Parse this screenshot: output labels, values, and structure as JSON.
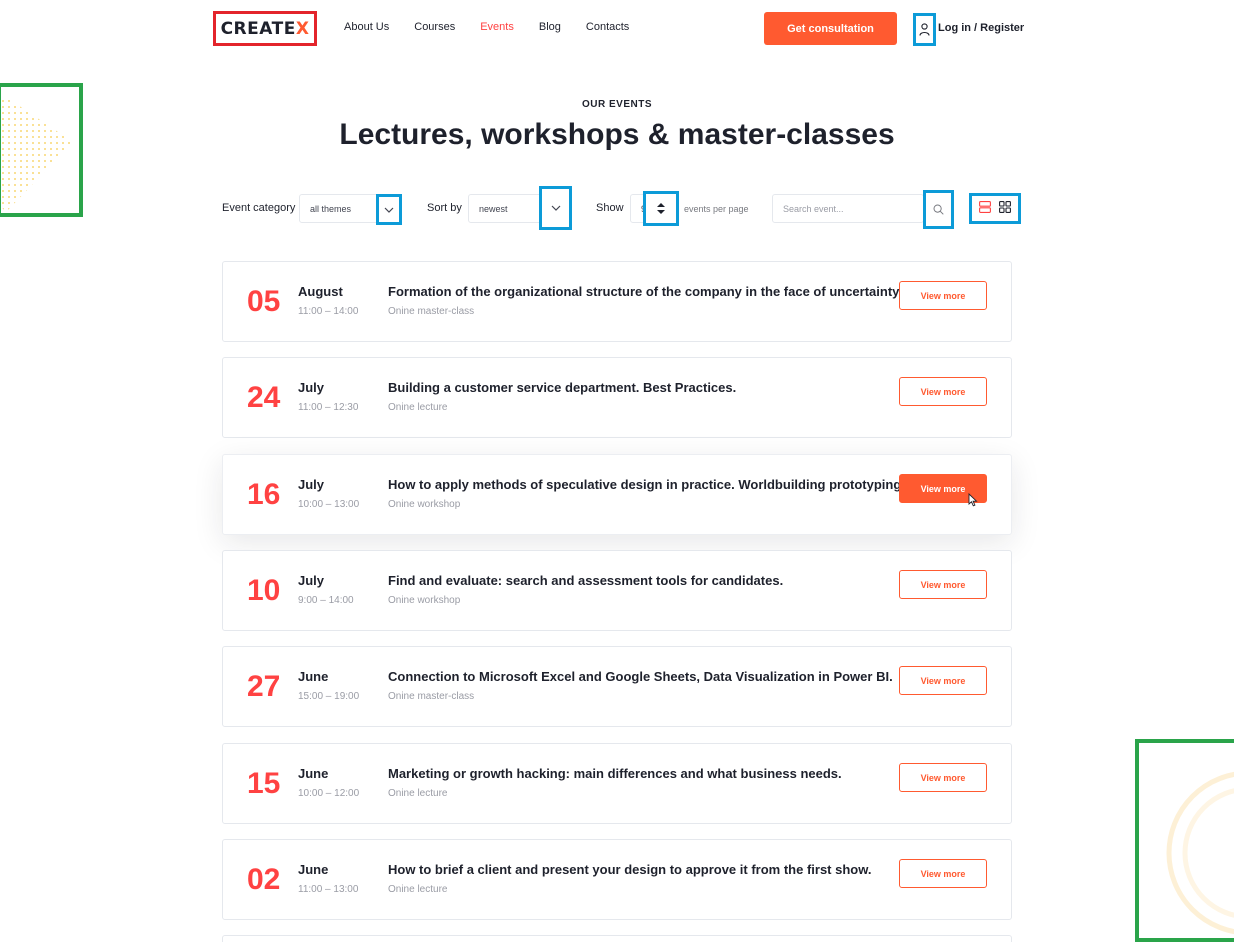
{
  "header": {
    "logo_text": "CREATE",
    "logo_accent": "X",
    "nav": [
      "About Us",
      "Courses",
      "Events",
      "Blog",
      "Contacts"
    ],
    "active_nav": "Events",
    "cta_label": "Get consultation",
    "login_label": "Log in / Register"
  },
  "hero": {
    "overline": "OUR EVENTS",
    "title": "Lectures, workshops & master-classes"
  },
  "filters": {
    "category_label": "Event category",
    "category_value": "all themes",
    "sort_label": "Sort by",
    "sort_value": "newest",
    "show_label": "Show",
    "show_value": "9",
    "per_page_label": "events per page",
    "search_placeholder": "Search event..."
  },
  "events": [
    {
      "day": "05",
      "month": "August",
      "time": "11:00 – 14:00",
      "title": "Formation of the organizational structure of the company in the face of uncertainty.",
      "type": "Onine master-class",
      "button": "View more"
    },
    {
      "day": "24",
      "month": "July",
      "time": "11:00 – 12:30",
      "title": "Building a customer service department. Best Practices.",
      "type": "Onine lecture",
      "button": "View more"
    },
    {
      "day": "16",
      "month": "July",
      "time": "10:00 – 13:00",
      "title": "How to apply methods of speculative design in practice. Worldbuilding prototyping.",
      "type": "Onine workshop",
      "button": "View more"
    },
    {
      "day": "10",
      "month": "July",
      "time": "9:00 – 14:00",
      "title": "Find and evaluate: search and assessment tools for candidates.",
      "type": "Onine workshop",
      "button": "View more"
    },
    {
      "day": "27",
      "month": "June",
      "time": "15:00 – 19:00",
      "title": "Connection to Microsoft Excel and Google Sheets, Data Visualization in Power BI.",
      "type": "Onine master-class",
      "button": "View more"
    },
    {
      "day": "15",
      "month": "June",
      "time": "10:00 – 12:00",
      "title": "Marketing or growth hacking: main differences and what business needs.",
      "type": "Onine lecture",
      "button": "View more"
    },
    {
      "day": "02",
      "month": "June",
      "time": "11:00 – 13:00",
      "title": "How to brief a client and present your design to approve it from the first show.",
      "type": "Onine lecture",
      "button": "View more"
    }
  ],
  "colors": {
    "accent": "#ff5a30",
    "date_red": "#ff4242",
    "highlight_blue": "#0c9bd8",
    "logo_red": "#e3242b",
    "deco_green": "#2aa44a"
  }
}
